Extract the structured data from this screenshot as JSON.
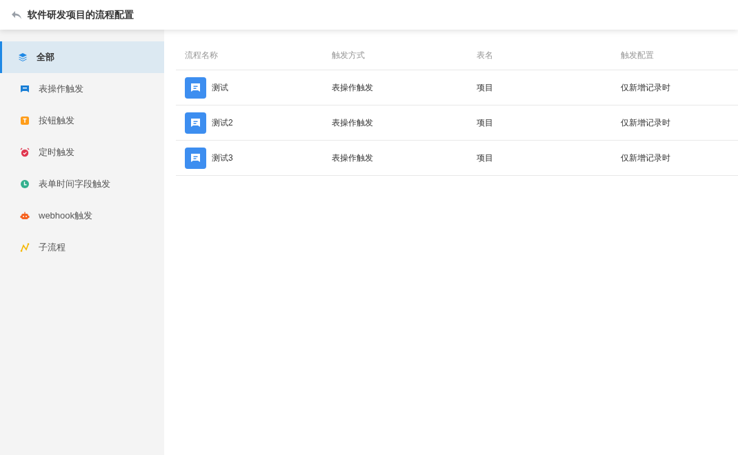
{
  "header": {
    "title": "软件研发项目的流程配置"
  },
  "sidebar": {
    "items": [
      {
        "label": "全部",
        "kind": "layers",
        "selected": true
      },
      {
        "label": "表操作触发",
        "kind": "table",
        "selected": false
      },
      {
        "label": "按钮触发",
        "kind": "button",
        "selected": false
      },
      {
        "label": "定时触发",
        "kind": "alarm",
        "selected": false
      },
      {
        "label": "表单时间字段触发",
        "kind": "clock",
        "selected": false
      },
      {
        "label": "webhook触发",
        "kind": "robot",
        "selected": false
      },
      {
        "label": "子流程",
        "kind": "subflow",
        "selected": false
      }
    ]
  },
  "table": {
    "columns": [
      "流程名称",
      "触发方式",
      "表名",
      "触发配置"
    ],
    "rows": [
      {
        "name": "测试",
        "trigger": "表操作触发",
        "table_name": "项目",
        "config": "仅新增记录时"
      },
      {
        "name": "测试2",
        "trigger": "表操作触发",
        "table_name": "项目",
        "config": "仅新增记录时"
      },
      {
        "name": "测试3",
        "trigger": "表操作触发",
        "table_name": "项目",
        "config": "仅新增记录时"
      }
    ]
  }
}
